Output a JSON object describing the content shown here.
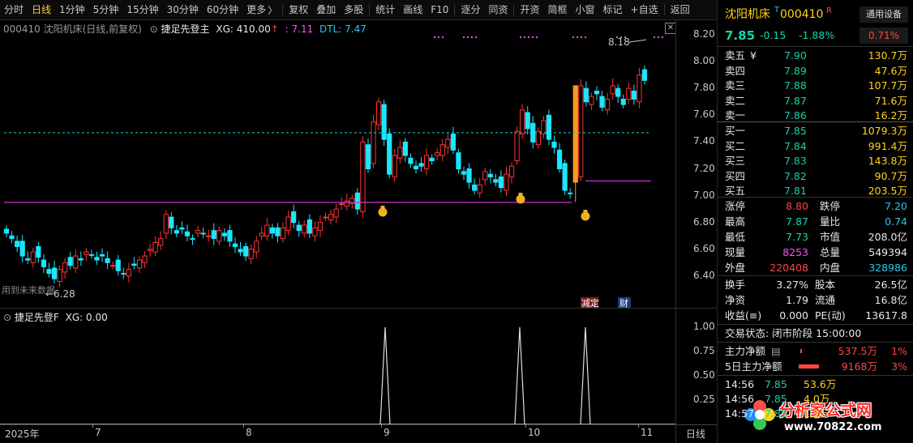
{
  "toolbar": {
    "items": [
      "分时",
      "日线",
      "1分钟",
      "5分钟",
      "15分钟",
      "30分钟",
      "60分钟",
      "更多",
      "复权",
      "叠加",
      "多股",
      "统计",
      "画线",
      "F10",
      "逐分",
      "同资",
      "开资",
      "简框",
      "小窗",
      "标记",
      "+自选",
      "返回"
    ],
    "more_arrow": "〉",
    "active_index": 1
  },
  "chart_header": {
    "code_name": "000410 沈阳机床(日线,前复权)",
    "indicator": "捷足先登主",
    "xg_label": "XG: 410.00",
    "xg_arrow": "↑",
    "value1": ": 7.11",
    "dtl_label": "DTL: 7.47"
  },
  "main_chart": {
    "price_ticks": [
      "8.20",
      "8.00",
      "7.80",
      "7.60",
      "7.40",
      "7.20",
      "7.00",
      "6.80",
      "6.60",
      "6.40"
    ],
    "high_label": "8.18",
    "low_label": "6.28",
    "future_data_label": "用到未来数据",
    "event_labels": [
      "减定",
      "财"
    ],
    "colors": {
      "up": "#ff3232",
      "down": "#19e6ff",
      "ma_line": "#cc33cc",
      "dtl_line": "#1ed2d2",
      "highlight_bar": "#ff9a1e"
    }
  },
  "sub_chart": {
    "indicator": "捷足先登F",
    "xg_label": "XG: 0.00",
    "ticks": [
      "1.00",
      "0.75",
      "0.50",
      "0.25"
    ]
  },
  "x_axis": {
    "labels": [
      "2025年",
      "7",
      "8",
      "9",
      "10",
      "11"
    ],
    "period": "日线"
  },
  "right_panel": {
    "name": "沈阳机床",
    "superscript": "T",
    "code": "000410",
    "r_badge": "R",
    "device": "通用设备",
    "price": "7.85",
    "change": "-0.15",
    "change_pct": "-1.88%",
    "turnover_badge": "0.71%",
    "asks": [
      {
        "label": "卖五",
        "flag": "¥",
        "price": "7.90",
        "vol": "130.7万"
      },
      {
        "label": "卖四",
        "flag": "",
        "price": "7.89",
        "vol": "47.6万"
      },
      {
        "label": "卖三",
        "flag": "",
        "price": "7.88",
        "vol": "107.7万"
      },
      {
        "label": "卖二",
        "flag": "",
        "price": "7.87",
        "vol": "71.6万"
      },
      {
        "label": "卖一",
        "flag": "",
        "price": "7.86",
        "vol": "16.2万"
      }
    ],
    "bids": [
      {
        "label": "买一",
        "price": "7.85",
        "vol": "1079.3万"
      },
      {
        "label": "买二",
        "price": "7.84",
        "vol": "991.4万"
      },
      {
        "label": "买三",
        "price": "7.83",
        "vol": "143.8万"
      },
      {
        "label": "买四",
        "price": "7.82",
        "vol": "90.7万"
      },
      {
        "label": "买五",
        "price": "7.81",
        "vol": "203.5万"
      }
    ],
    "stats1": [
      {
        "l1": "涨停",
        "v1": "8.80",
        "l2": "跌停",
        "v2": "7.20"
      },
      {
        "l1": "最高",
        "v1": "7.87",
        "l2": "量比",
        "v2": "0.74"
      },
      {
        "l1": "最低",
        "v1": "7.73",
        "l2": "市值",
        "v2": "208.0亿"
      },
      {
        "l1": "现量",
        "v1": "8253",
        "l2": "总量",
        "v2": "549394"
      },
      {
        "l1": "外盘",
        "v1": "220408",
        "l2": "内盘",
        "v2": "328986"
      }
    ],
    "stats2": [
      {
        "l1": "换手",
        "v1": "3.27%",
        "l2": "股本",
        "v2": "26.5亿"
      },
      {
        "l1": "净资",
        "v1": "1.79",
        "l2": "流通",
        "v2": "16.8亿"
      },
      {
        "l1": "收益(≡)",
        "v1": "0.000",
        "l2": "PE(动)",
        "v2": "13617.8"
      }
    ],
    "trade_status": "交易状态: 闭市阶段 15:00:00",
    "capital": [
      {
        "label": "主力净额",
        "icon": "▤",
        "value": "537.5万",
        "pct": "1%"
      },
      {
        "label": "5日主力净额",
        "icon": "",
        "value": "9168万",
        "pct": "3%"
      }
    ],
    "ticks": [
      {
        "time": "14:56",
        "price": "7.85",
        "vol": "53.6万"
      },
      {
        "time": "14:56",
        "price": "7.85",
        "vol": "4.0万"
      },
      {
        "time": "14:57",
        "price": "7.85",
        "vol": "1.2万"
      }
    ],
    "watermark": {
      "title": "分析家公式网",
      "url": "www.70822.com"
    }
  }
}
